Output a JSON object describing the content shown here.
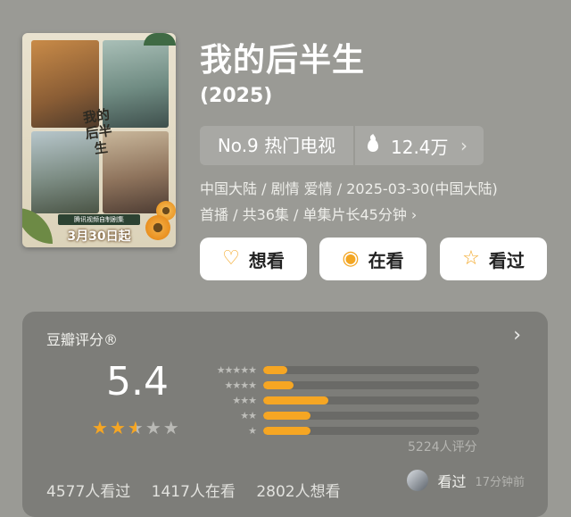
{
  "poster": {
    "title_art": "我的后半生",
    "tag": "腾讯视频自制剧集",
    "date_text": "3月30日起"
  },
  "header": {
    "title": "我的后半生",
    "year": "(2025)"
  },
  "rank": {
    "label": "No.9 热门电视",
    "heat": "12.4万",
    "chevron": "›"
  },
  "meta": {
    "line1": "中国大陆 / 剧情 爱情 / 2025-03-30(中国大陆)",
    "line2": "首播 / 共36集 / 单集片长45分钟 ›"
  },
  "actions": {
    "want_label": "想看",
    "watching_label": "在看",
    "watched_label": "看过"
  },
  "rating": {
    "heading": "豆瓣评分®",
    "score": "5.4",
    "stars_filled": 2.5,
    "star_levels": [
      "★★★★★",
      "★★★★",
      "★★★",
      "★★",
      "★"
    ],
    "distribution_fraction": [
      0.11,
      0.14,
      0.3,
      0.22,
      0.22
    ],
    "votes_text": "5224人评分",
    "colors": {
      "accent": "#f6a623",
      "track": "#6a6a67"
    }
  },
  "stats": {
    "watched": "4577人看过",
    "watching": "1417人在看",
    "want": "2802人想看"
  },
  "user_activity": {
    "action": "看过",
    "time": "17分钟前"
  }
}
